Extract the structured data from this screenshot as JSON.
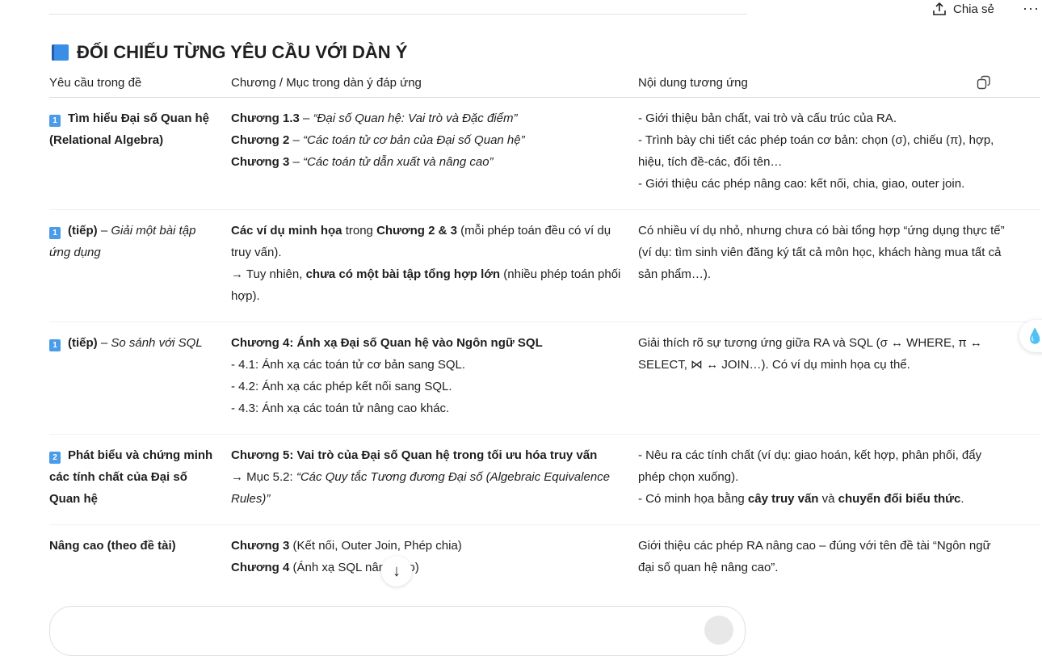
{
  "header": {
    "share_label": "Chia sẻ",
    "more_label": "···"
  },
  "title": "ĐỐI CHIẾU TỪNG YÊU CẦU VỚI DÀN Ý",
  "table": {
    "headers": [
      "Yêu cầu trong đề",
      "Chương / Mục trong dàn ý đáp ứng",
      "Nội dung tương ứng"
    ],
    "rows": [
      {
        "badge": "1",
        "cells": [
          [
            [
              {
                "t": "Tìm hiểu Đại số Quan hệ (Relational Algebra)",
                "b": true
              }
            ]
          ],
          [
            [
              {
                "t": "Chương 1.3",
                "b": true
              },
              {
                "t": " – "
              },
              {
                "t": "“Đại số Quan hệ: Vai trò và Đặc điểm”",
                "i": true
              }
            ],
            [
              {
                "t": "Chương 2",
                "b": true
              },
              {
                "t": " – "
              },
              {
                "t": "“Các toán tử cơ bản của Đại số Quan hệ”",
                "i": true
              }
            ],
            [
              {
                "t": "Chương 3",
                "b": true
              },
              {
                "t": " – "
              },
              {
                "t": "“Các toán tử dẫn xuất và nâng cao”",
                "i": true
              }
            ]
          ],
          [
            [
              {
                "t": "- Giới thiệu bản chất, vai trò và cấu trúc của RA."
              }
            ],
            [
              {
                "t": "- Trình bày chi tiết các phép toán cơ bản: chọn (σ), chiếu (π), hợp, hiệu, tích đề-các, đổi tên…"
              }
            ],
            [
              {
                "t": "- Giới thiệu các phép nâng cao: kết nối, chia, giao, outer join."
              }
            ]
          ]
        ]
      },
      {
        "badge": "1",
        "cells": [
          [
            [
              {
                "t": "(tiếp)",
                "b": true
              },
              {
                "t": " – "
              },
              {
                "t": "Giải một bài tập ứng dụng",
                "i": true
              }
            ]
          ],
          [
            [
              {
                "t": "Các ví dụ minh họa",
                "b": true
              },
              {
                "t": " trong "
              },
              {
                "t": "Chương 2 & 3",
                "b": true
              },
              {
                "t": " (mỗi phép toán đều có ví dụ truy vấn)."
              }
            ],
            [
              {
                "t": "→ Tuy nhiên, "
              },
              {
                "t": "chưa có một bài tập tổng hợp lớn",
                "b": true
              },
              {
                "t": " (nhiều phép toán phối hợp)."
              }
            ]
          ],
          [
            [
              {
                "t": "Có nhiều ví dụ nhỏ, nhưng chưa có bài tổng hợp “ứng dụng thực tế” (ví dụ: tìm sinh viên đăng ký tất cả môn học, khách hàng mua tất cả sản phẩm…)."
              }
            ]
          ]
        ]
      },
      {
        "badge": "1",
        "cells": [
          [
            [
              {
                "t": "(tiếp)",
                "b": true
              },
              {
                "t": " – "
              },
              {
                "t": "So sánh với SQL",
                "i": true
              }
            ]
          ],
          [
            [
              {
                "t": "Chương 4: Ánh xạ Đại số Quan hệ vào Ngôn ngữ SQL",
                "b": true
              }
            ],
            [
              {
                "t": "- 4.1: Ánh xạ các toán tử cơ bản sang SQL."
              }
            ],
            [
              {
                "t": "- 4.2: Ánh xạ các phép kết nối sang SQL."
              }
            ],
            [
              {
                "t": "- 4.3: Ánh xạ các toán tử nâng cao khác."
              }
            ]
          ],
          [
            [
              {
                "t": "Giải thích rõ sự tương ứng giữa RA và SQL (σ ↔ WHERE, π ↔ SELECT, ⋈ ↔ JOIN…). Có ví dụ minh họa cụ thể."
              }
            ]
          ]
        ]
      },
      {
        "badge": "2",
        "cells": [
          [
            [
              {
                "t": "Phát biểu và chứng minh các tính chất của Đại số Quan hệ",
                "b": true
              }
            ]
          ],
          [
            [
              {
                "t": "Chương 5: Vai trò của Đại số Quan hệ trong tối ưu hóa truy vấn",
                "b": true
              }
            ],
            [
              {
                "t": "→ Mục 5.2: "
              },
              {
                "t": "“Các Quy tắc Tương đương Đại số (Algebraic Equivalence Rules)”",
                "i": true
              }
            ]
          ],
          [
            [
              {
                "t": "- Nêu ra các tính chất (ví dụ: giao hoán, kết hợp, phân phối, đẩy phép chọn xuống)."
              }
            ],
            [
              {
                "t": "- Có minh họa bằng "
              },
              {
                "t": "cây truy vấn",
                "b": true
              },
              {
                "t": " và "
              },
              {
                "t": "chuyển đổi biểu thức",
                "b": true
              },
              {
                "t": "."
              }
            ]
          ]
        ]
      },
      {
        "badge": "",
        "cells": [
          [
            [
              {
                "t": "Nâng cao (theo đề tài)",
                "b": true
              }
            ]
          ],
          [
            [
              {
                "t": "Chương 3",
                "b": true
              },
              {
                "t": " (Kết nối, Outer Join, Phép chia)"
              }
            ],
            [
              {
                "t": "Chương 4",
                "b": true
              },
              {
                "t": " (Ánh xạ SQL nâng cao)"
              }
            ]
          ],
          [
            [
              {
                "t": "Giới thiệu các phép RA nâng cao – đúng với tên đề tài “Ngôn ngữ đại số quan hệ nâng cao”."
              }
            ]
          ]
        ]
      }
    ]
  },
  "colors": {
    "accent": "#4a9be8",
    "border": "#dcdcdc"
  }
}
